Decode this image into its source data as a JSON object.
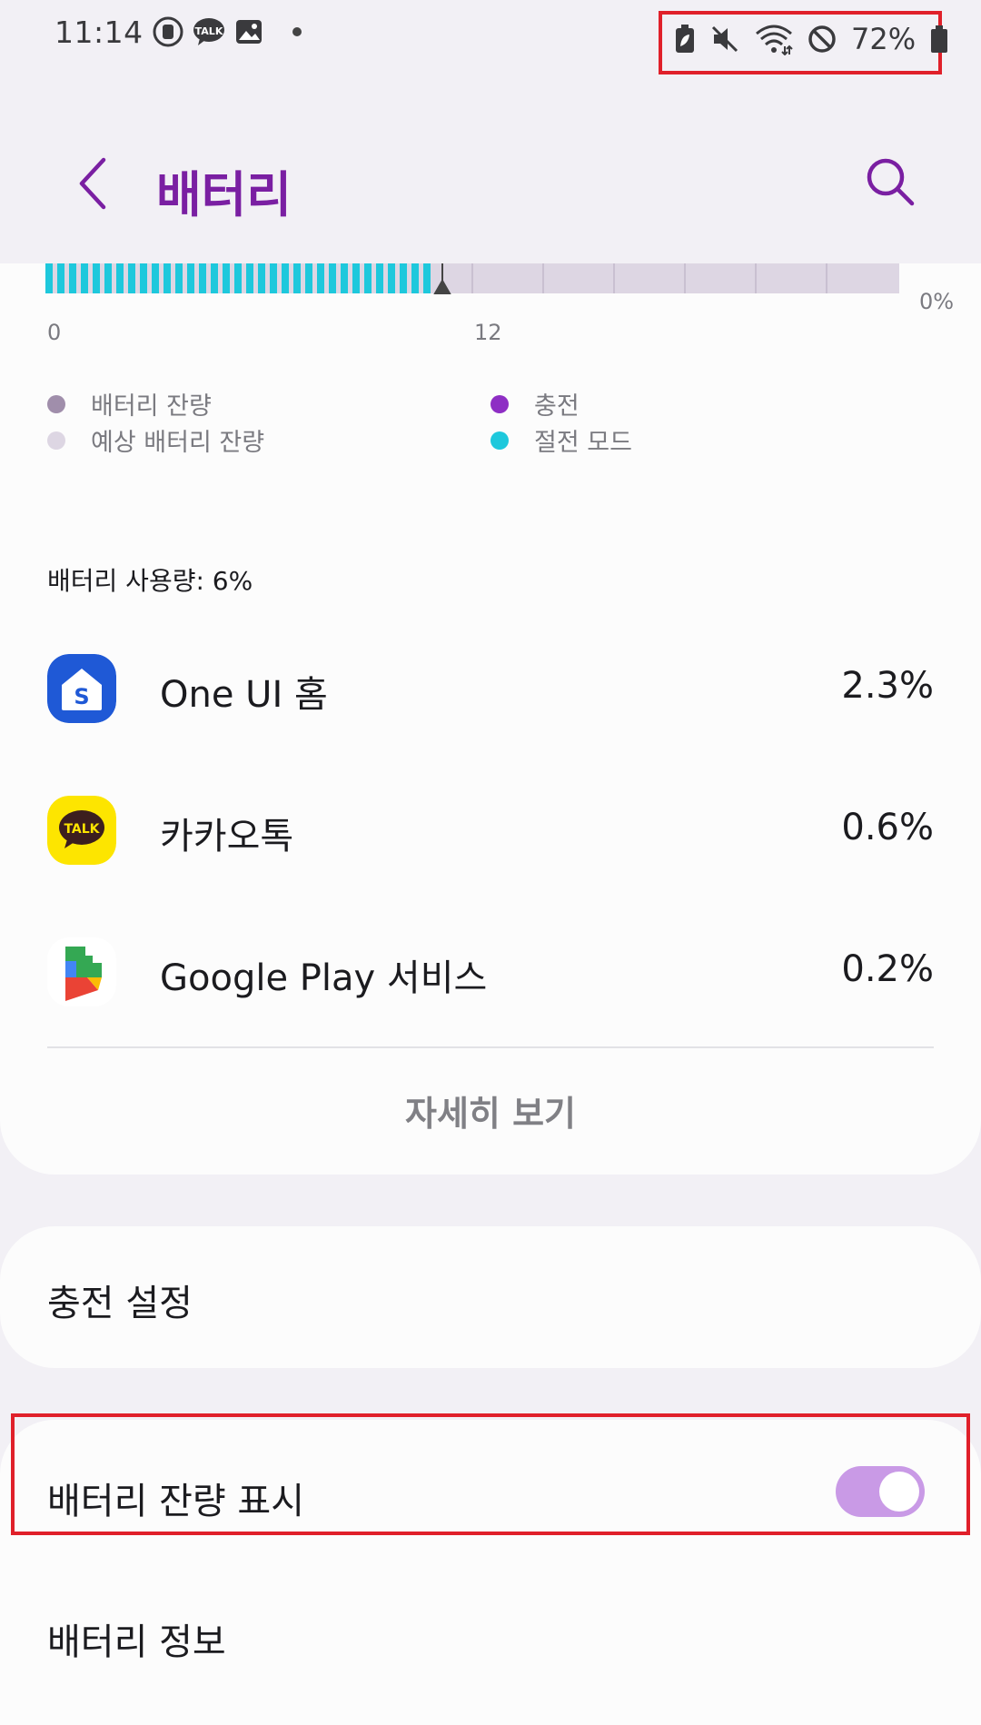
{
  "status_bar": {
    "time": "11:14",
    "battery_percent": "72%",
    "left_icons": [
      "screen-recorder-icon",
      "kakaotalk-talk-icon",
      "gallery-icon",
      "notification-dot-icon"
    ],
    "right_icons": [
      "battery-saver-icon",
      "mute-icon",
      "wifi-icon",
      "do-not-disturb-icon",
      "battery-icon"
    ]
  },
  "app_bar": {
    "title": "배터리",
    "back_icon": "chevron-left-icon",
    "search_icon": "search-icon",
    "accent": "#7a1fa2"
  },
  "chart_data": {
    "type": "bar",
    "x_tick_labels": [
      "0",
      "12"
    ],
    "y_tick_labels": [
      "0%"
    ],
    "current_marker_at": "12",
    "legend": [
      {
        "label": "배터리 잔량",
        "color": "#a08eab"
      },
      {
        "label": "충전",
        "color": "#8e2ec4"
      },
      {
        "label": "예상 배터리 잔량",
        "color": "#ddd6e3"
      },
      {
        "label": "절전 모드",
        "color": "#1ec8dc"
      }
    ]
  },
  "usage": {
    "title": "배터리 사용량: 6%",
    "apps": [
      {
        "name": "One UI 홈",
        "percent": "2.3%",
        "icon": "one-ui-home-icon"
      },
      {
        "name": "카카오톡",
        "percent": "0.6%",
        "icon": "kakaotalk-icon"
      },
      {
        "name": "Google Play 서비스",
        "percent": "0.2%",
        "icon": "google-play-services-icon"
      }
    ],
    "details_label": "자세히 보기"
  },
  "settings": {
    "charging_settings": "충전 설정",
    "show_battery_percentage": "배터리 잔량 표시",
    "show_battery_percentage_on": true,
    "battery_info": "배터리 정보"
  },
  "kakao_talk_label": "TALK"
}
